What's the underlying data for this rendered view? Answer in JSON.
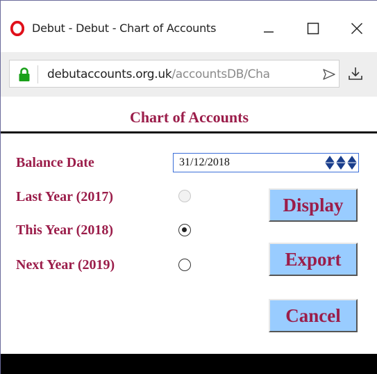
{
  "window": {
    "title": "Debut - Debut - Chart of Accounts",
    "controls": {
      "minimize": "minimize",
      "maximize": "maximize",
      "close": "close"
    }
  },
  "address": {
    "domain": "debutaccounts.org.uk",
    "path": "/accountsDB/Cha"
  },
  "page": {
    "title": "Chart of Accounts",
    "balance_date_label": "Balance Date",
    "balance_date_value": "31/12/2018",
    "options": [
      {
        "label": "Last Year (2017)",
        "selected": false,
        "disabled": true
      },
      {
        "label": "This Year (2018)",
        "selected": true,
        "disabled": false
      },
      {
        "label": "Next Year (2019)",
        "selected": false,
        "disabled": false
      }
    ],
    "buttons": {
      "display": "Display",
      "export": "Export",
      "cancel": "Cancel"
    }
  },
  "colors": {
    "label": "#9b1d4a",
    "button_bg": "#99ccff",
    "spinner": "#1a3e8c"
  }
}
